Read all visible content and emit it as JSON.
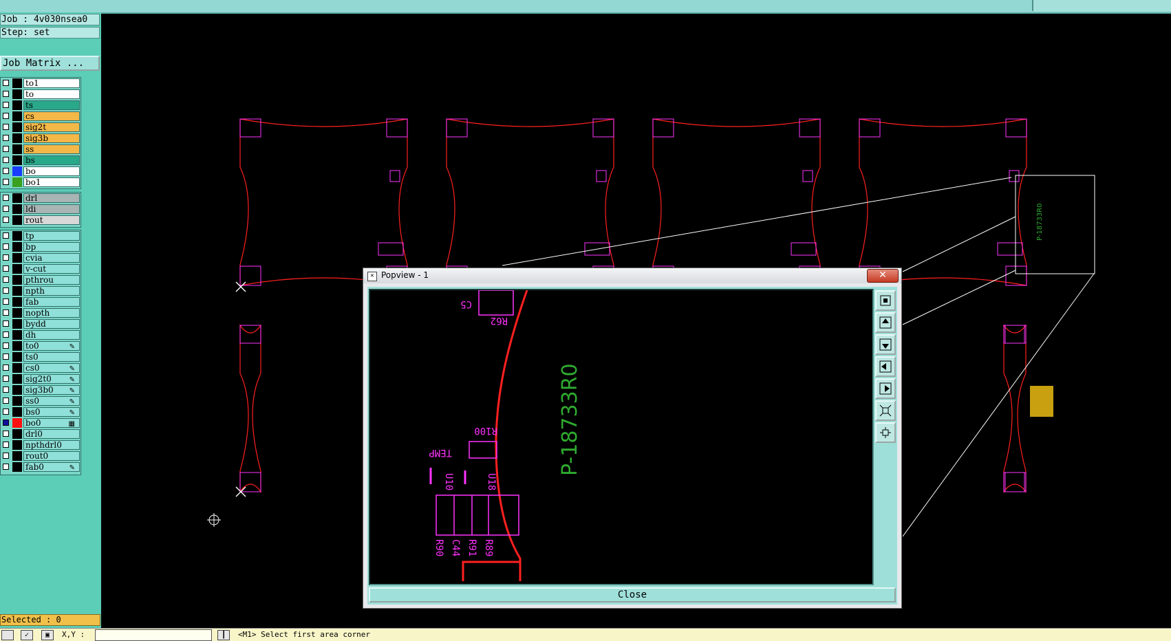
{
  "job_label": "Job : 4v030nsea0",
  "step_label": "Step: set",
  "job_matrix_button": "Job Matrix ...",
  "colors": {
    "panel": "#5ccdb7",
    "layer_white": "#ffffff",
    "layer_green": "#2aa88a",
    "layer_orange": "#f4b848",
    "layer_gray": "#a9b5b5",
    "layer_teal": "#8fe0d8",
    "board_outline": "#ff2020",
    "silk_magenta": "#ff33ff",
    "text_green": "#2faa2f"
  },
  "layers": {
    "group1": [
      {
        "name": "to1",
        "color": "white",
        "swatch": ""
      },
      {
        "name": "to",
        "color": "white",
        "swatch": ""
      },
      {
        "name": "ts",
        "color": "green",
        "swatch": ""
      },
      {
        "name": "cs",
        "color": "orange",
        "swatch": ""
      },
      {
        "name": "sig2t",
        "color": "orange",
        "swatch": ""
      },
      {
        "name": "sig3b",
        "color": "orange",
        "swatch": ""
      },
      {
        "name": "ss",
        "color": "orange",
        "swatch": ""
      },
      {
        "name": "bs",
        "color": "green",
        "swatch": ""
      },
      {
        "name": "bo",
        "color": "white",
        "swatch": "#1a3cff"
      },
      {
        "name": "bo1",
        "color": "white",
        "swatch": "#3aa020"
      }
    ],
    "group2": [
      {
        "name": "drl",
        "color": "gray"
      },
      {
        "name": "ldi",
        "color": "gray"
      },
      {
        "name": "rout",
        "color": "lightgray"
      }
    ],
    "group3": [
      {
        "name": "tp"
      },
      {
        "name": "bp"
      },
      {
        "name": "cvia"
      },
      {
        "name": "v-cut"
      },
      {
        "name": "pthrou"
      },
      {
        "name": "npth"
      },
      {
        "name": "fab"
      },
      {
        "name": "nopth"
      },
      {
        "name": "bydd"
      },
      {
        "name": "dh"
      },
      {
        "name": "to0",
        "mark": "✎"
      },
      {
        "name": "ts0"
      },
      {
        "name": "cs0",
        "mark": "✎"
      },
      {
        "name": "sig2t0",
        "mark": "✎"
      },
      {
        "name": "sig3b0",
        "mark": "✎"
      },
      {
        "name": "ss0",
        "mark": "✎"
      },
      {
        "name": "bs0",
        "mark": "✎"
      },
      {
        "name": "bo0",
        "swatch": "#ff1010",
        "active": true,
        "mark": "▦"
      },
      {
        "name": "drl0"
      },
      {
        "name": "npthdrl0"
      },
      {
        "name": "rout0"
      },
      {
        "name": "fab0",
        "mark": "✎"
      }
    ]
  },
  "selected_label": "Selected : 0",
  "status": {
    "xy_label": "X,Y :",
    "xy_value": "",
    "prompt": "<M1>  Select first area corner"
  },
  "popview": {
    "title": "Popview - 1",
    "close_button": "Close",
    "part_number": "P-18733R0",
    "components": [
      "R62",
      "R100",
      "TEMP",
      "U10",
      "U18",
      "R90",
      "R91",
      "R89",
      "C44",
      "C5"
    ]
  },
  "main_view": {
    "part_number_small": "P-18733R0"
  }
}
